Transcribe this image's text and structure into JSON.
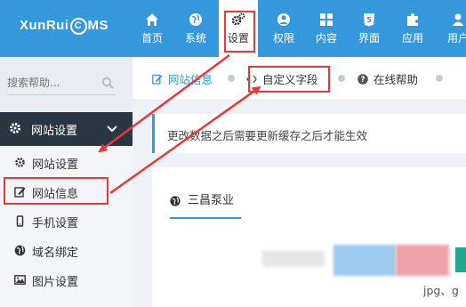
{
  "logo": {
    "pre": "XunRui",
    "c": "C",
    "post": "MS"
  },
  "nav": [
    {
      "label": "首页",
      "icon": "home-icon"
    },
    {
      "label": "系统",
      "icon": "globe-icon"
    },
    {
      "label": "设置",
      "icon": "gears-icon"
    },
    {
      "label": "权限",
      "icon": "user-circle-icon"
    },
    {
      "label": "内容",
      "icon": "grid-icon"
    },
    {
      "label": "界面",
      "icon": "html5-icon"
    },
    {
      "label": "应用",
      "icon": "puzzle-icon"
    },
    {
      "label": "用户",
      "icon": "user-icon"
    }
  ],
  "search": {
    "placeholder": "搜索帮助..."
  },
  "sidebar": {
    "group": "网站设置",
    "items": [
      {
        "label": "网站设置",
        "icon": "gear-icon"
      },
      {
        "label": "网站信息",
        "icon": "edit-icon"
      },
      {
        "label": "手机设置",
        "icon": "mobile-icon"
      },
      {
        "label": "域名绑定",
        "icon": "globe-icon"
      },
      {
        "label": "图片设置",
        "icon": "image-icon"
      }
    ]
  },
  "breadcrumbs": [
    {
      "label": "网站信息",
      "icon": "edit-icon"
    },
    {
      "label": "自定义字段",
      "icon": "code-icon"
    },
    {
      "label": "在线帮助",
      "icon": "question-icon"
    }
  ],
  "notice": "更改数据之后需要更新缓存之后才能生效",
  "tab": {
    "label": "三昌泵业"
  },
  "filetypes": "jpg、g",
  "colors": {
    "primary": "#3598dc",
    "sidebar": "#364150",
    "highlight": "#e63a3a"
  }
}
